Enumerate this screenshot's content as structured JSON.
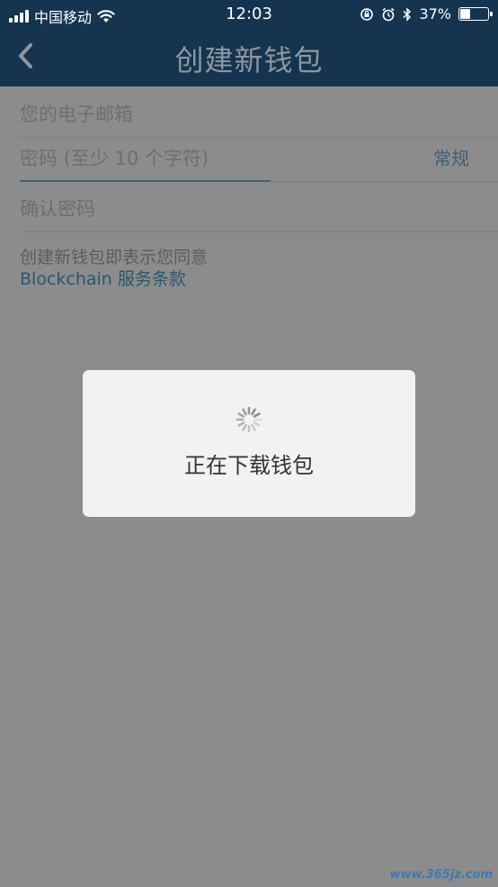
{
  "status_bar": {
    "carrier": "中国移动",
    "time": "12:03",
    "battery_percent": "37%",
    "battery_level": 0.37,
    "icons": [
      "signal-icon",
      "wifi-icon",
      "orientation-lock-icon",
      "alarm-icon",
      "bluetooth-icon",
      "battery-icon"
    ]
  },
  "nav": {
    "title": "创建新钱包",
    "back_icon": "chevron-left-icon"
  },
  "form": {
    "email_placeholder": "您的电子邮箱",
    "password_placeholder": "密码 (至少 10 个字符)",
    "password_strength": "常规",
    "confirm_placeholder": "确认密码"
  },
  "terms": {
    "text": "创建新钱包即表示您同意",
    "link": "Blockchain 服务条款"
  },
  "dialog": {
    "message": "正在下载钱包",
    "spinner_icon": "loading-spinner-icon"
  },
  "watermark": "www.365jz.com",
  "colors": {
    "header": "#15344f",
    "overlay_background": "#8c8c8c",
    "link": "#2a566f",
    "dialog": "#f2f2f2"
  }
}
